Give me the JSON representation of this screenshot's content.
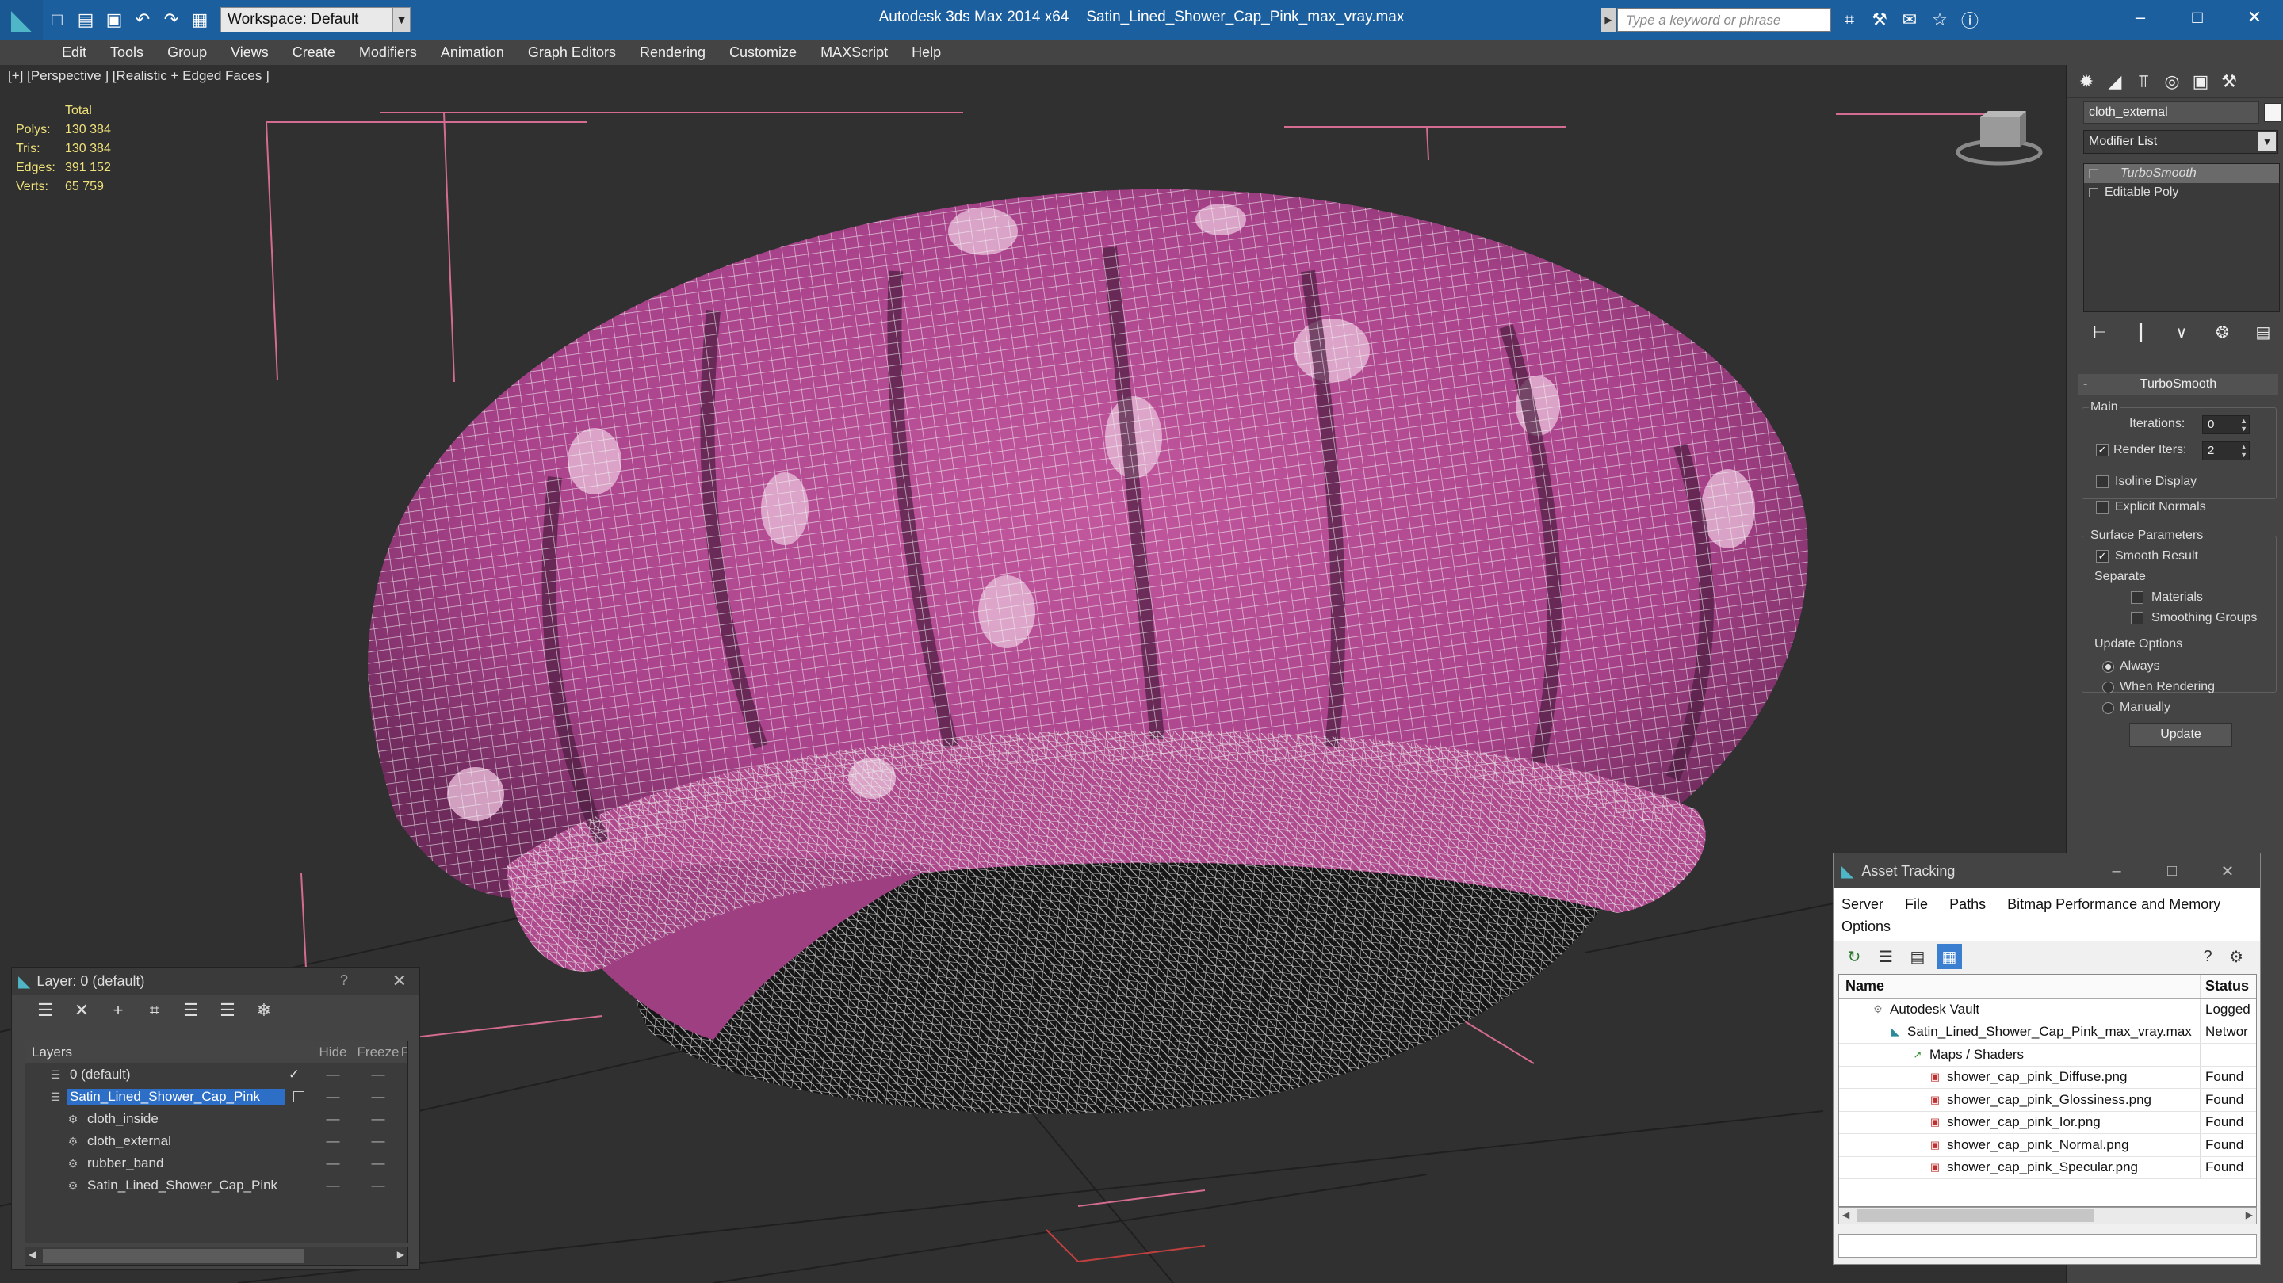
{
  "titlebar": {
    "workspace": "Workspace: Default",
    "app": "Autodesk 3ds Max  2014 x64",
    "file": "Satin_Lined_Shower_Cap_Pink_max_vray.max",
    "search_placeholder": "Type a keyword or phrase"
  },
  "menu": [
    "Edit",
    "Tools",
    "Group",
    "Views",
    "Create",
    "Modifiers",
    "Animation",
    "Graph Editors",
    "Rendering",
    "Customize",
    "MAXScript",
    "Help"
  ],
  "viewport": {
    "label": "[+] [Perspective ] [Realistic + Edged Faces ]",
    "stats_header": "Total",
    "stats": [
      {
        "k": "Polys:",
        "v": "130 384"
      },
      {
        "k": "Tris:",
        "v": "130 384"
      },
      {
        "k": "Edges:",
        "v": "391 152"
      },
      {
        "k": "Verts:",
        "v": "65 759"
      }
    ],
    "mesh_color": "#b44d92"
  },
  "command_panel": {
    "object_name": "cloth_external",
    "modifier_list": "Modifier List",
    "stack": [
      "TurboSmooth",
      "Editable Poly"
    ],
    "rollout": "TurboSmooth",
    "main": "Main",
    "iterations_label": "Iterations:",
    "iterations": "0",
    "render_iters_label": "Render Iters:",
    "render_iters": "2",
    "isoline": "Isoline Display",
    "explicit": "Explicit Normals",
    "surface_params": "Surface Parameters",
    "smooth_result": "Smooth Result",
    "separate": "Separate",
    "materials": "Materials",
    "smoothing_groups": "Smoothing Groups",
    "update_options": "Update Options",
    "always": "Always",
    "when_rendering": "When Rendering",
    "manually": "Manually",
    "update": "Update"
  },
  "layer_window": {
    "title": "Layer: 0 (default)",
    "help": "?",
    "col_layers": "Layers",
    "col_hide": "Hide",
    "col_freeze": "Freeze",
    "col_r": "R",
    "rows": [
      {
        "name": "0 (default)",
        "indent": 1
      },
      {
        "name": "Satin_Lined_Shower_Cap_Pink",
        "indent": 1
      },
      {
        "name": "cloth_inside",
        "indent": 2
      },
      {
        "name": "cloth_external",
        "indent": 2
      },
      {
        "name": "rubber_band",
        "indent": 2
      },
      {
        "name": "Satin_Lined_Shower_Cap_Pink",
        "indent": 2
      }
    ]
  },
  "asset_tracking": {
    "title": "Asset Tracking",
    "menu1": [
      "Server",
      "File",
      "Paths",
      "Bitmap Performance and Memory"
    ],
    "menu2": [
      "Options"
    ],
    "col_name": "Name",
    "col_status": "Status",
    "rows": [
      {
        "name": "Autodesk Vault",
        "status": "Logged",
        "indent": 1
      },
      {
        "name": "Satin_Lined_Shower_Cap_Pink_max_vray.max",
        "status": "Networ",
        "indent": 2
      },
      {
        "name": "Maps / Shaders",
        "status": "",
        "indent": 3
      },
      {
        "name": "shower_cap_pink_Diffuse.png",
        "status": "Found",
        "indent": 4
      },
      {
        "name": "shower_cap_pink_Glossiness.png",
        "status": "Found",
        "indent": 4
      },
      {
        "name": "shower_cap_pink_Ior.png",
        "status": "Found",
        "indent": 4
      },
      {
        "name": "shower_cap_pink_Normal.png",
        "status": "Found",
        "indent": 4
      },
      {
        "name": "shower_cap_pink_Specular.png",
        "status": "Found",
        "indent": 4
      }
    ]
  }
}
